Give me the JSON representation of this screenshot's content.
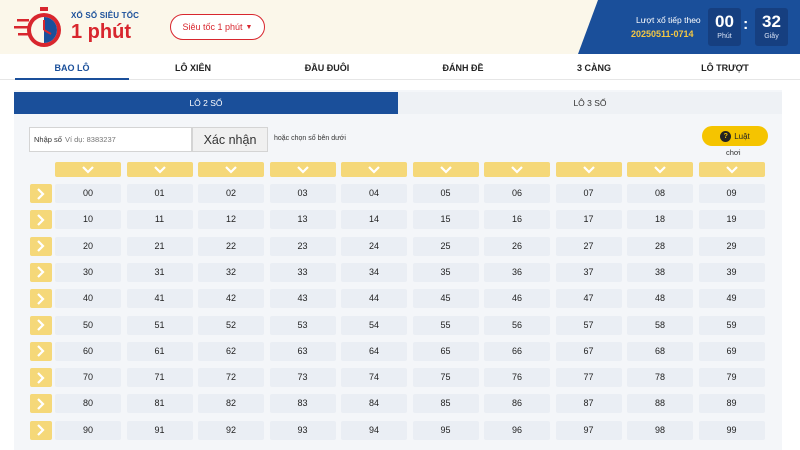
{
  "header": {
    "logo_small": "XỔ SỐ SIÊU TỐC",
    "logo_big": "1 phút",
    "mode": "Siêu tốc 1 phút",
    "next_label": "Lượt xổ tiếp theo",
    "next_id": "20250511-0714",
    "minutes": "00",
    "minutes_unit": "Phút",
    "seconds": "32",
    "seconds_unit": "Giây"
  },
  "tabs": [
    {
      "label": "BAO LÔ",
      "active": true
    },
    {
      "label": "LÔ XIÊN",
      "active": false
    },
    {
      "label": "ĐẦU ĐUÔI",
      "active": false
    },
    {
      "label": "ĐÁNH ĐỀ",
      "active": false
    },
    {
      "label": "3 CÀNG",
      "active": false
    },
    {
      "label": "LÔ TRƯỢT",
      "active": false
    }
  ],
  "subtabs": [
    {
      "label": "LÔ 2 SỐ",
      "active": true
    },
    {
      "label": "LÔ 3 SỐ",
      "active": false
    }
  ],
  "input": {
    "label": "Nhập số",
    "placeholder": "Ví dụ: 8383237",
    "confirm": "Xác nhận",
    "hint": "hoặc chọn số bên dưới"
  },
  "rules": {
    "label": "Luật",
    "sub": "chơi"
  },
  "grid": {
    "rows": [
      [
        "00",
        "01",
        "02",
        "03",
        "04",
        "05",
        "06",
        "07",
        "08",
        "09"
      ],
      [
        "10",
        "11",
        "12",
        "13",
        "14",
        "15",
        "16",
        "17",
        "18",
        "19"
      ],
      [
        "20",
        "21",
        "22",
        "23",
        "24",
        "25",
        "26",
        "27",
        "28",
        "29"
      ],
      [
        "30",
        "31",
        "32",
        "33",
        "34",
        "35",
        "36",
        "37",
        "38",
        "39"
      ],
      [
        "40",
        "41",
        "42",
        "43",
        "44",
        "45",
        "46",
        "47",
        "48",
        "49"
      ],
      [
        "50",
        "51",
        "52",
        "53",
        "54",
        "55",
        "56",
        "57",
        "58",
        "59"
      ],
      [
        "60",
        "61",
        "62",
        "63",
        "64",
        "65",
        "66",
        "67",
        "68",
        "69"
      ],
      [
        "70",
        "71",
        "72",
        "73",
        "74",
        "75",
        "76",
        "77",
        "78",
        "79"
      ],
      [
        "80",
        "81",
        "82",
        "83",
        "84",
        "85",
        "86",
        "87",
        "88",
        "89"
      ],
      [
        "90",
        "91",
        "92",
        "93",
        "94",
        "95",
        "96",
        "97",
        "98",
        "99"
      ]
    ]
  },
  "colors": {
    "brand_blue": "#1a4f9a",
    "brand_red": "#d8262e",
    "accent_yellow": "#f5d879",
    "timer_yellow": "#f5c842"
  }
}
